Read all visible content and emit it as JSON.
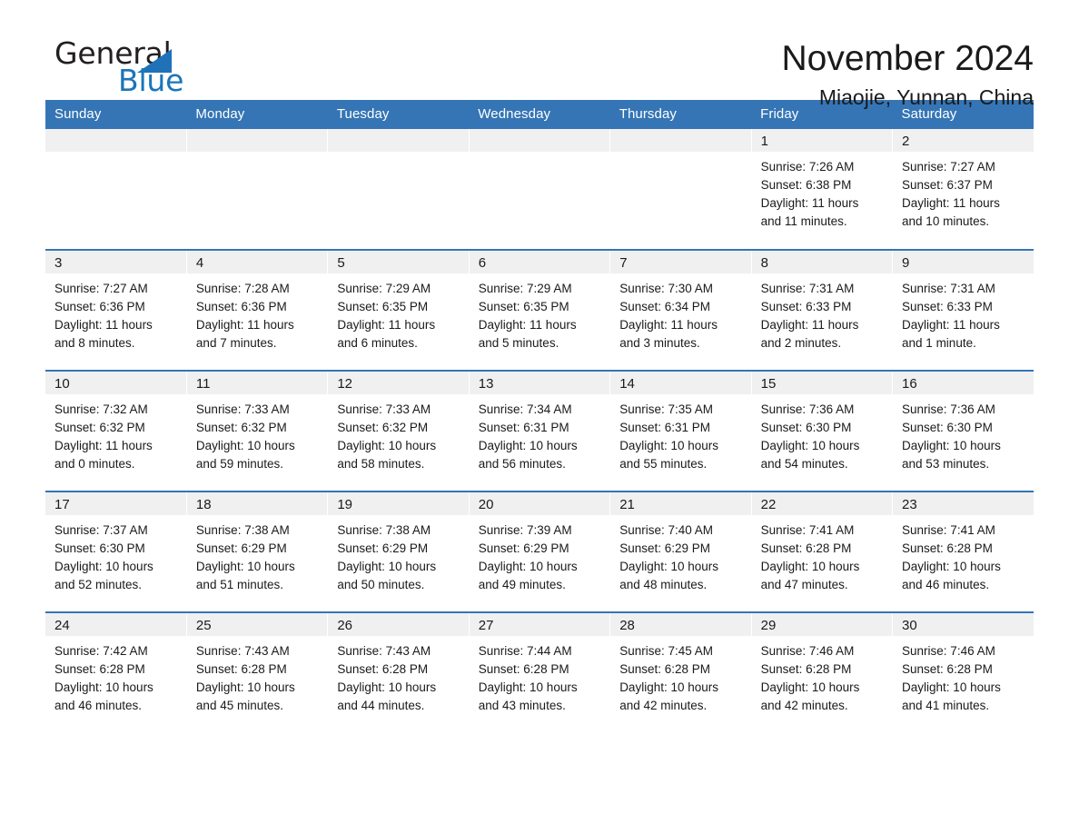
{
  "logo": {
    "word_one": "General",
    "word_two": "Blue",
    "triangle_color": "#1f72b8",
    "blue_text_color": "#1b75bb"
  },
  "header": {
    "month_title": "November 2024",
    "location": "Miaojie, Yunnan, China",
    "header_bg_color": "#3575b5",
    "daynum_band_color": "#f0f0f0"
  },
  "weekday_headers": [
    "Sunday",
    "Monday",
    "Tuesday",
    "Wednesday",
    "Thursday",
    "Friday",
    "Saturday"
  ],
  "weeks": [
    [
      {
        "day": "",
        "sunrise": "",
        "sunset": "",
        "daylight_line1": "",
        "daylight_line2": "",
        "empty": true
      },
      {
        "day": "",
        "sunrise": "",
        "sunset": "",
        "daylight_line1": "",
        "daylight_line2": "",
        "empty": true
      },
      {
        "day": "",
        "sunrise": "",
        "sunset": "",
        "daylight_line1": "",
        "daylight_line2": "",
        "empty": true
      },
      {
        "day": "",
        "sunrise": "",
        "sunset": "",
        "daylight_line1": "",
        "daylight_line2": "",
        "empty": true
      },
      {
        "day": "",
        "sunrise": "",
        "sunset": "",
        "daylight_line1": "",
        "daylight_line2": "",
        "empty": true
      },
      {
        "day": "1",
        "sunrise": "Sunrise: 7:26 AM",
        "sunset": "Sunset: 6:38 PM",
        "daylight_line1": "Daylight: 11 hours",
        "daylight_line2": "and 11 minutes.",
        "empty": false
      },
      {
        "day": "2",
        "sunrise": "Sunrise: 7:27 AM",
        "sunset": "Sunset: 6:37 PM",
        "daylight_line1": "Daylight: 11 hours",
        "daylight_line2": "and 10 minutes.",
        "empty": false
      }
    ],
    [
      {
        "day": "3",
        "sunrise": "Sunrise: 7:27 AM",
        "sunset": "Sunset: 6:36 PM",
        "daylight_line1": "Daylight: 11 hours",
        "daylight_line2": "and 8 minutes.",
        "empty": false
      },
      {
        "day": "4",
        "sunrise": "Sunrise: 7:28 AM",
        "sunset": "Sunset: 6:36 PM",
        "daylight_line1": "Daylight: 11 hours",
        "daylight_line2": "and 7 minutes.",
        "empty": false
      },
      {
        "day": "5",
        "sunrise": "Sunrise: 7:29 AM",
        "sunset": "Sunset: 6:35 PM",
        "daylight_line1": "Daylight: 11 hours",
        "daylight_line2": "and 6 minutes.",
        "empty": false
      },
      {
        "day": "6",
        "sunrise": "Sunrise: 7:29 AM",
        "sunset": "Sunset: 6:35 PM",
        "daylight_line1": "Daylight: 11 hours",
        "daylight_line2": "and 5 minutes.",
        "empty": false
      },
      {
        "day": "7",
        "sunrise": "Sunrise: 7:30 AM",
        "sunset": "Sunset: 6:34 PM",
        "daylight_line1": "Daylight: 11 hours",
        "daylight_line2": "and 3 minutes.",
        "empty": false
      },
      {
        "day": "8",
        "sunrise": "Sunrise: 7:31 AM",
        "sunset": "Sunset: 6:33 PM",
        "daylight_line1": "Daylight: 11 hours",
        "daylight_line2": "and 2 minutes.",
        "empty": false
      },
      {
        "day": "9",
        "sunrise": "Sunrise: 7:31 AM",
        "sunset": "Sunset: 6:33 PM",
        "daylight_line1": "Daylight: 11 hours",
        "daylight_line2": "and 1 minute.",
        "empty": false
      }
    ],
    [
      {
        "day": "10",
        "sunrise": "Sunrise: 7:32 AM",
        "sunset": "Sunset: 6:32 PM",
        "daylight_line1": "Daylight: 11 hours",
        "daylight_line2": "and 0 minutes.",
        "empty": false
      },
      {
        "day": "11",
        "sunrise": "Sunrise: 7:33 AM",
        "sunset": "Sunset: 6:32 PM",
        "daylight_line1": "Daylight: 10 hours",
        "daylight_line2": "and 59 minutes.",
        "empty": false
      },
      {
        "day": "12",
        "sunrise": "Sunrise: 7:33 AM",
        "sunset": "Sunset: 6:32 PM",
        "daylight_line1": "Daylight: 10 hours",
        "daylight_line2": "and 58 minutes.",
        "empty": false
      },
      {
        "day": "13",
        "sunrise": "Sunrise: 7:34 AM",
        "sunset": "Sunset: 6:31 PM",
        "daylight_line1": "Daylight: 10 hours",
        "daylight_line2": "and 56 minutes.",
        "empty": false
      },
      {
        "day": "14",
        "sunrise": "Sunrise: 7:35 AM",
        "sunset": "Sunset: 6:31 PM",
        "daylight_line1": "Daylight: 10 hours",
        "daylight_line2": "and 55 minutes.",
        "empty": false
      },
      {
        "day": "15",
        "sunrise": "Sunrise: 7:36 AM",
        "sunset": "Sunset: 6:30 PM",
        "daylight_line1": "Daylight: 10 hours",
        "daylight_line2": "and 54 minutes.",
        "empty": false
      },
      {
        "day": "16",
        "sunrise": "Sunrise: 7:36 AM",
        "sunset": "Sunset: 6:30 PM",
        "daylight_line1": "Daylight: 10 hours",
        "daylight_line2": "and 53 minutes.",
        "empty": false
      }
    ],
    [
      {
        "day": "17",
        "sunrise": "Sunrise: 7:37 AM",
        "sunset": "Sunset: 6:30 PM",
        "daylight_line1": "Daylight: 10 hours",
        "daylight_line2": "and 52 minutes.",
        "empty": false
      },
      {
        "day": "18",
        "sunrise": "Sunrise: 7:38 AM",
        "sunset": "Sunset: 6:29 PM",
        "daylight_line1": "Daylight: 10 hours",
        "daylight_line2": "and 51 minutes.",
        "empty": false
      },
      {
        "day": "19",
        "sunrise": "Sunrise: 7:38 AM",
        "sunset": "Sunset: 6:29 PM",
        "daylight_line1": "Daylight: 10 hours",
        "daylight_line2": "and 50 minutes.",
        "empty": false
      },
      {
        "day": "20",
        "sunrise": "Sunrise: 7:39 AM",
        "sunset": "Sunset: 6:29 PM",
        "daylight_line1": "Daylight: 10 hours",
        "daylight_line2": "and 49 minutes.",
        "empty": false
      },
      {
        "day": "21",
        "sunrise": "Sunrise: 7:40 AM",
        "sunset": "Sunset: 6:29 PM",
        "daylight_line1": "Daylight: 10 hours",
        "daylight_line2": "and 48 minutes.",
        "empty": false
      },
      {
        "day": "22",
        "sunrise": "Sunrise: 7:41 AM",
        "sunset": "Sunset: 6:28 PM",
        "daylight_line1": "Daylight: 10 hours",
        "daylight_line2": "and 47 minutes.",
        "empty": false
      },
      {
        "day": "23",
        "sunrise": "Sunrise: 7:41 AM",
        "sunset": "Sunset: 6:28 PM",
        "daylight_line1": "Daylight: 10 hours",
        "daylight_line2": "and 46 minutes.",
        "empty": false
      }
    ],
    [
      {
        "day": "24",
        "sunrise": "Sunrise: 7:42 AM",
        "sunset": "Sunset: 6:28 PM",
        "daylight_line1": "Daylight: 10 hours",
        "daylight_line2": "and 46 minutes.",
        "empty": false
      },
      {
        "day": "25",
        "sunrise": "Sunrise: 7:43 AM",
        "sunset": "Sunset: 6:28 PM",
        "daylight_line1": "Daylight: 10 hours",
        "daylight_line2": "and 45 minutes.",
        "empty": false
      },
      {
        "day": "26",
        "sunrise": "Sunrise: 7:43 AM",
        "sunset": "Sunset: 6:28 PM",
        "daylight_line1": "Daylight: 10 hours",
        "daylight_line2": "and 44 minutes.",
        "empty": false
      },
      {
        "day": "27",
        "sunrise": "Sunrise: 7:44 AM",
        "sunset": "Sunset: 6:28 PM",
        "daylight_line1": "Daylight: 10 hours",
        "daylight_line2": "and 43 minutes.",
        "empty": false
      },
      {
        "day": "28",
        "sunrise": "Sunrise: 7:45 AM",
        "sunset": "Sunset: 6:28 PM",
        "daylight_line1": "Daylight: 10 hours",
        "daylight_line2": "and 42 minutes.",
        "empty": false
      },
      {
        "day": "29",
        "sunrise": "Sunrise: 7:46 AM",
        "sunset": "Sunset: 6:28 PM",
        "daylight_line1": "Daylight: 10 hours",
        "daylight_line2": "and 42 minutes.",
        "empty": false
      },
      {
        "day": "30",
        "sunrise": "Sunrise: 7:46 AM",
        "sunset": "Sunset: 6:28 PM",
        "daylight_line1": "Daylight: 10 hours",
        "daylight_line2": "and 41 minutes.",
        "empty": false
      }
    ]
  ]
}
